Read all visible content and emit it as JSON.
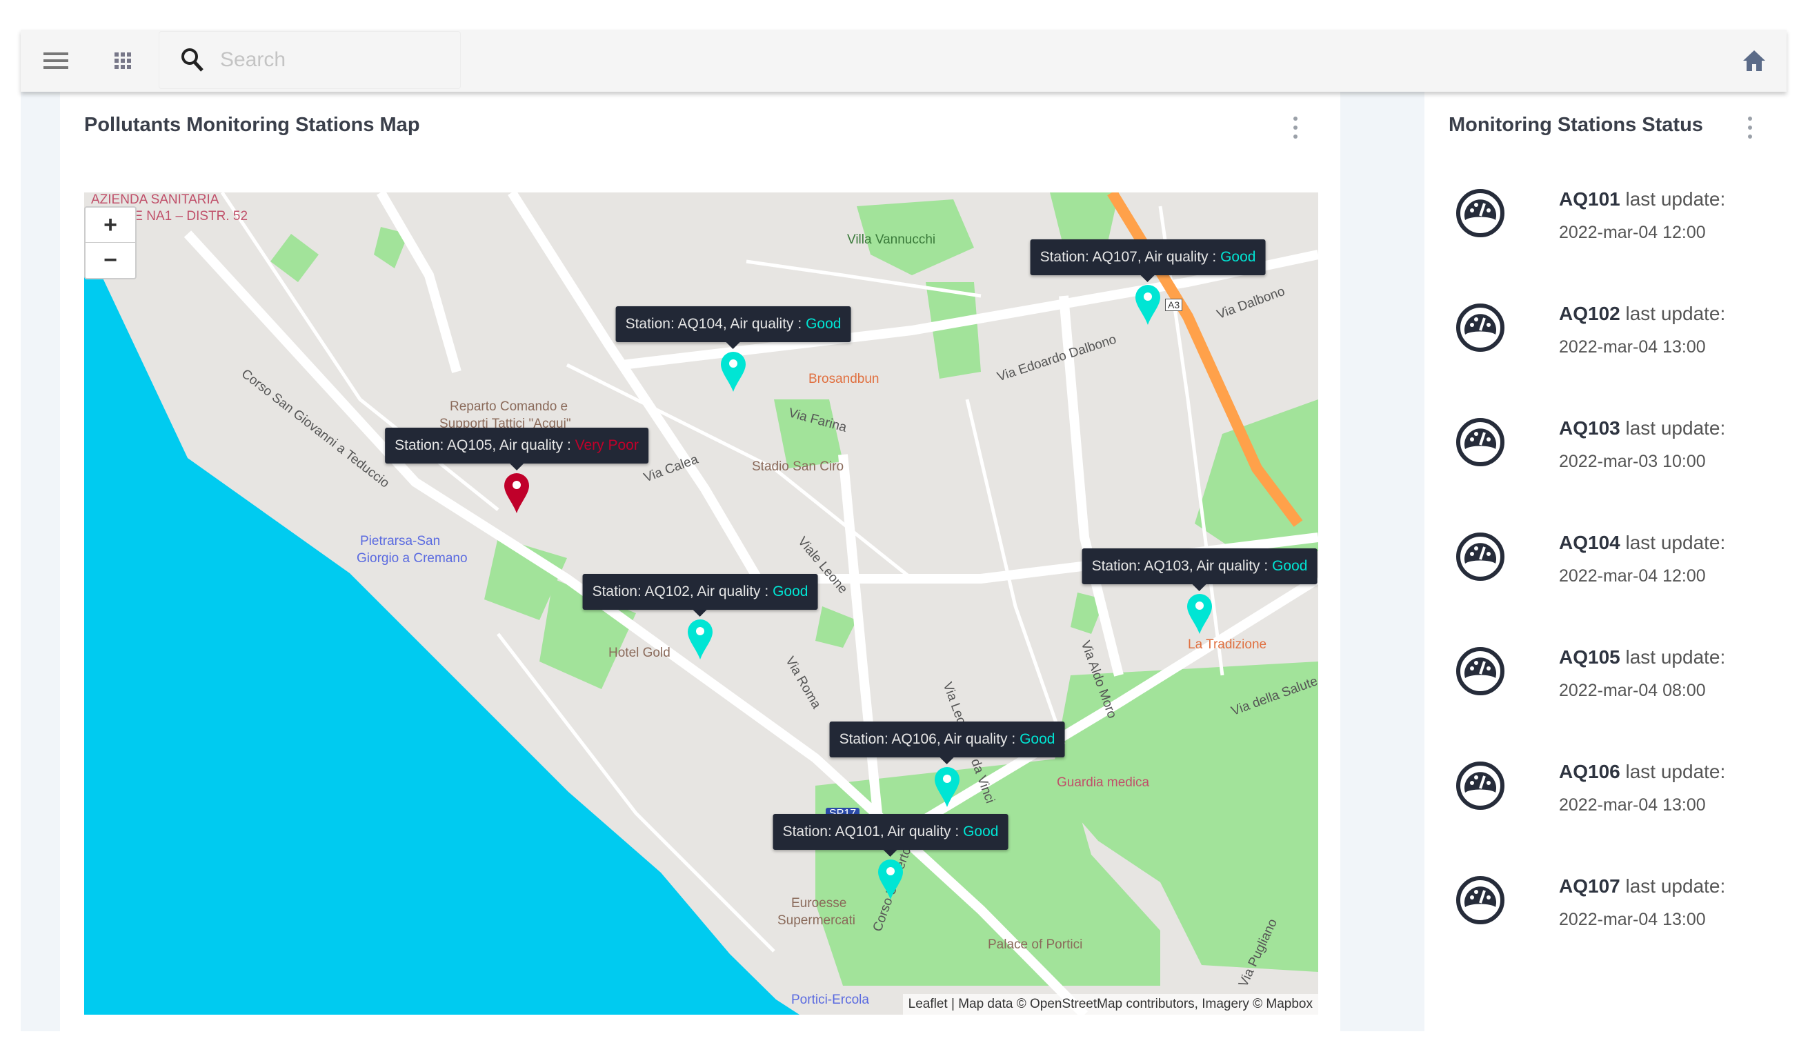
{
  "topbar": {
    "search_placeholder": "Search",
    "icons": [
      "menu-icon",
      "apps-grid-icon",
      "search-icon",
      "home-icon"
    ]
  },
  "map_card": {
    "title": "Pollutants Monitoring Stations Map",
    "zoom_in": "+",
    "zoom_out": "−",
    "attribution": "Leaflet | Map data © OpenStreetMap contributors, Imagery © Mapbox",
    "labels": [
      "AZIENDA SANITARIA",
      "LOCALE NA1 – DISTR. 52",
      "Villa Vannucchi",
      "Corso San Giovanni a Teduccio",
      "Reparto Comando e",
      "Supporti Tattici \"Acqui\"",
      "Pietrarsa-San",
      "Giorgio a Cremano",
      "Brosandbun",
      "Via Farina",
      "Stadio San Ciro",
      "Via Calea",
      "Via Edoardo Dalbono",
      "Via Dalbono",
      "Viale Leone",
      "Hotel Gold",
      "Via Roma",
      "Via Leonardo da Vinci",
      "Via Aldo Moro",
      "La Tradizione",
      "Via della Salute",
      "Guardia medica",
      "SP17",
      "Euroesse",
      "Supermercati",
      "Corso Umberto",
      "Palace of Portici",
      "Portici-Ercola",
      "Via Pugliano",
      "A3"
    ],
    "stations": [
      {
        "id": "AQ104",
        "prefix": "Station: AQ104, Air quality : ",
        "quality": "Good",
        "color": "#00e5d4"
      },
      {
        "id": "AQ107",
        "prefix": "Station: AQ107, Air quality : ",
        "quality": "Good",
        "color": "#00e5d4"
      },
      {
        "id": "AQ105",
        "prefix": "Station: AQ105, Air quality : ",
        "quality": "Very Poor",
        "color": "#c0002a"
      },
      {
        "id": "AQ102",
        "prefix": "Station: AQ102, Air quality : ",
        "quality": "Good",
        "color": "#00e5d4"
      },
      {
        "id": "AQ103",
        "prefix": "Station: AQ103, Air quality : ",
        "quality": "Good",
        "color": "#00e5d4"
      },
      {
        "id": "AQ106",
        "prefix": "Station: AQ106, Air quality : ",
        "quality": "Good",
        "color": "#00e5d4"
      },
      {
        "id": "AQ101",
        "prefix": "Station: AQ101, Air quality : ",
        "quality": "Good",
        "color": "#00e5d4"
      }
    ]
  },
  "status_card": {
    "title": "Monitoring Stations Status",
    "suffix": " last update:",
    "items": [
      {
        "id": "AQ101",
        "date": "2022-mar-04 12:00"
      },
      {
        "id": "AQ102",
        "date": "2022-mar-04 13:00"
      },
      {
        "id": "AQ103",
        "date": "2022-mar-03 10:00"
      },
      {
        "id": "AQ104",
        "date": "2022-mar-04 12:00"
      },
      {
        "id": "AQ105",
        "date": "2022-mar-04 08:00"
      },
      {
        "id": "AQ106",
        "date": "2022-mar-04 13:00"
      },
      {
        "id": "AQ107",
        "date": "2022-mar-04 13:00"
      }
    ]
  }
}
